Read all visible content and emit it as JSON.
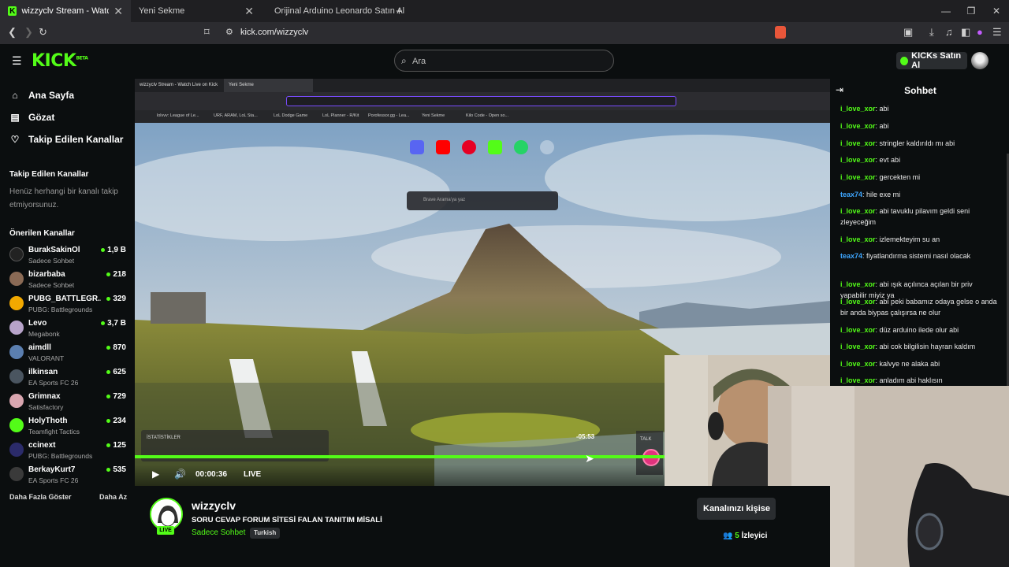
{
  "browser": {
    "tabs": [
      {
        "title": "wizzyclv Stream - Watch Live on Kick",
        "active": true
      },
      {
        "title": "Yeni Sekme",
        "active": false
      },
      {
        "title": "Orijinal Arduino Leonardo Satın Al",
        "active": false
      }
    ],
    "url": "kick.com/wizzyclv"
  },
  "header": {
    "logo": "KICK",
    "logo_beta": "BETA",
    "search_placeholder": "Ara",
    "kicks_button": "KICKs Satın Al"
  },
  "sidebar": {
    "nav": [
      {
        "label": "Ana Sayfa",
        "icon": "home-icon"
      },
      {
        "label": "Gözat",
        "icon": "browse-icon"
      },
      {
        "label": "Takip Edilen Kanallar",
        "icon": "heart-icon"
      }
    ],
    "followed_heading": "Takip Edilen Kanallar",
    "followed_empty": "Henüz herhangi bir kanalı takip etmiyorsunuz.",
    "recommended_heading": "Önerilen Kanallar",
    "channels": [
      {
        "name": "BurakSakinOl",
        "category": "Sadece Sohbet",
        "viewers": "1,9 B"
      },
      {
        "name": "bizarbaba",
        "category": "Sadece Sohbet",
        "viewers": "218"
      },
      {
        "name": "PUBG_BATTLEGR...",
        "category": "PUBG: Battlegrounds",
        "viewers": "329"
      },
      {
        "name": "Levo",
        "category": "Megabonk",
        "viewers": "3,7 B"
      },
      {
        "name": "aimdll",
        "category": "VALORANT",
        "viewers": "870"
      },
      {
        "name": "ilkinsan",
        "category": "EA Sports FC 26",
        "viewers": "625"
      },
      {
        "name": "Grimnax",
        "category": "Satisfactory",
        "viewers": "729"
      },
      {
        "name": "HolyThoth",
        "category": "Teamfight Tactics",
        "viewers": "234"
      },
      {
        "name": "ccinext",
        "category": "PUBG: Battlegrounds",
        "viewers": "125"
      },
      {
        "name": "BerkayKurt7",
        "category": "EA Sports FC 26",
        "viewers": "535"
      }
    ],
    "show_more": "Daha Fazla Göster",
    "show_less": "Daha Az"
  },
  "player": {
    "inner_tabs": [
      "wizzyclv Stream - Watch Live on Kick",
      "Yeni Sekme"
    ],
    "inner_bookmarks": [
      "lolvvv: League of Le...",
      "URF, ARAM, LoL Sta...",
      "LoL Dodge Game",
      "LoL Planner - R/Kit",
      "Porofessor.gg - Lea...",
      "Yeni Sekme",
      "Kilo Code - Open so..."
    ],
    "inner_search_placeholder": "Brave Arama'ya yaz",
    "stats_label": "İSTATİSTİKLER",
    "talk_label": "TALK",
    "time_remaining": "-05:53",
    "elapsed": "00:00:36",
    "live_label": "LIVE",
    "progress_percent": 91
  },
  "channel_info": {
    "name": "wizzyclv",
    "live_badge": "LIVE",
    "title": "SORU CEVAP FORUM SİTESİ FALAN TANITIM MİSALİ",
    "category": "Sadece Sohbet",
    "language": "Turkish",
    "customize_button": "Kanalınızı kişise",
    "viewer_count": "5",
    "viewer_label": "İzleyici"
  },
  "chat": {
    "title": "Sohbet",
    "messages": [
      {
        "user": "i_love_xor",
        "color": "#53fc18",
        "text": "abi"
      },
      {
        "user": "i_love_xor",
        "color": "#53fc18",
        "text": "abi"
      },
      {
        "user": "i_love_xor",
        "color": "#53fc18",
        "text": "stringler kaldırıldı mı abi"
      },
      {
        "user": "i_love_xor",
        "color": "#53fc18",
        "text": "evt abi"
      },
      {
        "user": "i_love_xor",
        "color": "#53fc18",
        "text": "gercekten mi"
      },
      {
        "user": "teax74",
        "color": "#3ea6ff",
        "text": "hile exe mi"
      },
      {
        "user": "i_love_xor",
        "color": "#53fc18",
        "text": "abi tavuklu pilavım geldi seni zleyeceğim"
      },
      {
        "user": "i_love_xor",
        "color": "#53fc18",
        "text": "izlemekteyim su an"
      },
      {
        "user": "teax74",
        "color": "#3ea6ff",
        "text": "fiyatlandırma sistemi nasıl olacak"
      },
      {
        "user": "i_love_xor",
        "color": "#53fc18",
        "text": "abi ışık açılınca açılan bir priv yapabilir miyiz ya"
      },
      {
        "user": "i_love_xor",
        "color": "#53fc18",
        "text": "abi peki babamız odaya gelse o anda bir anda biypas çalışırsa ne olur"
      },
      {
        "user": "i_love_xor",
        "color": "#53fc18",
        "text": "düz arduino ilede olur abi"
      },
      {
        "user": "i_love_xor",
        "color": "#53fc18",
        "text": "abi cok bilgilisin hayran kaldım"
      },
      {
        "user": "i_love_xor",
        "color": "#53fc18",
        "text": "kalvye ne alaka abi"
      },
      {
        "user": "i_love_xor",
        "color": "#53fc18",
        "text": "anladım abi haklısın"
      }
    ]
  },
  "colors": {
    "brand_green": "#53fc18",
    "background": "#0b0e0f",
    "mute_pink": "#e0337d"
  }
}
